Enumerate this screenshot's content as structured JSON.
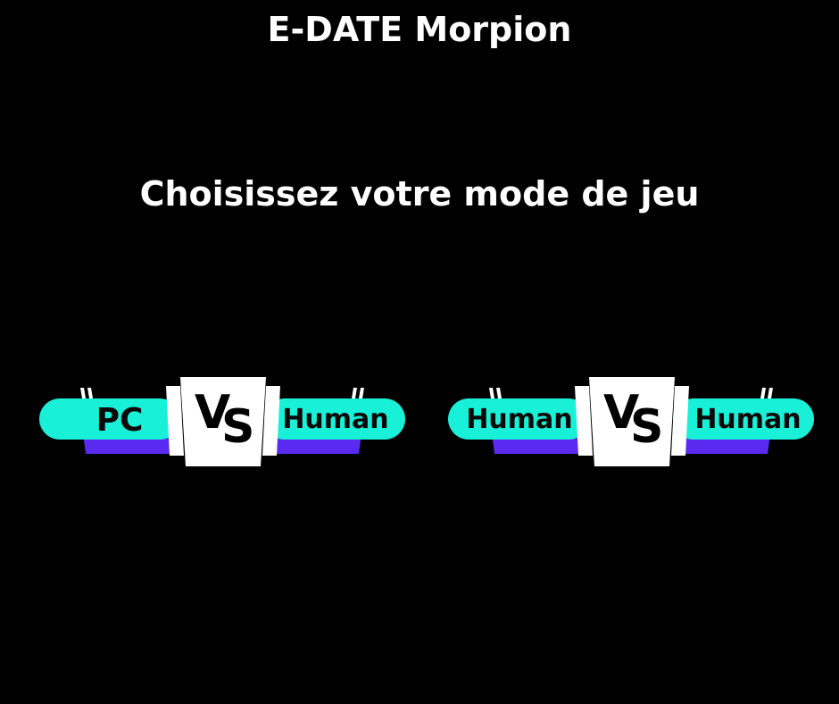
{
  "header": {
    "title": "E-DATE Morpion"
  },
  "menu": {
    "prompt": "Choisissez votre mode de jeu",
    "modes": [
      {
        "left": "PC",
        "vs": [
          "V",
          "S"
        ],
        "right": "Human"
      },
      {
        "left": "Human",
        "vs": [
          "V",
          "S"
        ],
        "right": "Human"
      }
    ]
  },
  "colors": {
    "background": "#000000",
    "text": "#ffffff",
    "banner_fill": "#18f0d8",
    "banner_shadow": "#5a2af0",
    "vs_box": "#ffffff"
  }
}
